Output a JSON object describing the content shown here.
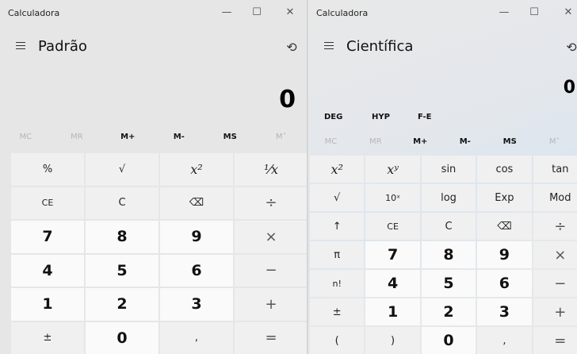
{
  "left": {
    "app_title": "Calculadora",
    "window_controls": {
      "minimize": "—",
      "maximize": "☐",
      "close": "✕"
    },
    "mode": "Padrão",
    "history_icon": "history-icon",
    "display_value": "0",
    "memory": [
      {
        "label": "MC",
        "enabled": false
      },
      {
        "label": "MR",
        "enabled": false
      },
      {
        "label": "M+",
        "enabled": true
      },
      {
        "label": "M-",
        "enabled": true
      },
      {
        "label": "MS",
        "enabled": true
      },
      {
        "label": "M˅",
        "enabled": false
      }
    ],
    "keys": [
      [
        "%",
        "√",
        "x²",
        "¹⁄x"
      ],
      [
        "CE",
        "C",
        "⌫",
        "÷"
      ],
      [
        "7",
        "8",
        "9",
        "×"
      ],
      [
        "4",
        "5",
        "6",
        "−"
      ],
      [
        "1",
        "2",
        "3",
        "+"
      ],
      [
        "±",
        "0",
        ",",
        "="
      ]
    ]
  },
  "right": {
    "app_title": "Calculadora",
    "window_controls": {
      "minimize": "—",
      "maximize": "☐",
      "close": "✕"
    },
    "mode": "Científica",
    "history_icon": "history-icon",
    "display_value": "0",
    "trig_labels": [
      "DEG",
      "HYP",
      "F-E"
    ],
    "memory": [
      {
        "label": "MC",
        "enabled": false
      },
      {
        "label": "MR",
        "enabled": false
      },
      {
        "label": "M+",
        "enabled": true
      },
      {
        "label": "M-",
        "enabled": true
      },
      {
        "label": "MS",
        "enabled": true
      },
      {
        "label": "M˅",
        "enabled": false
      }
    ],
    "keys": [
      [
        "x²",
        "xʸ",
        "sin",
        "cos",
        "tan"
      ],
      [
        "√",
        "10ˣ",
        "log",
        "Exp",
        "Mod"
      ],
      [
        "↑",
        "CE",
        "C",
        "⌫",
        "÷"
      ],
      [
        "π",
        "7",
        "8",
        "9",
        "×"
      ],
      [
        "n!",
        "4",
        "5",
        "6",
        "−"
      ],
      [
        "±",
        "1",
        "2",
        "3",
        "+"
      ],
      [
        "(",
        ")",
        "0",
        ",",
        "="
      ]
    ]
  }
}
